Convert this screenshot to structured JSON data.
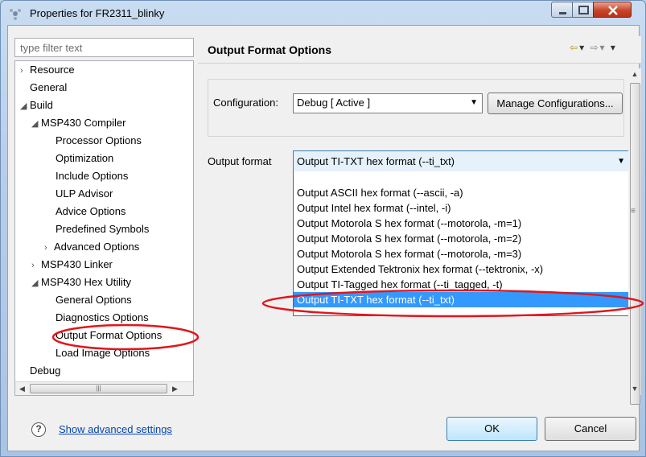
{
  "window": {
    "title": "Properties for FR2311_blinky"
  },
  "filter": {
    "placeholder": "type filter text"
  },
  "tree": {
    "items": [
      {
        "label": "Resource",
        "arrow": "›"
      },
      {
        "label": "General",
        "arrow": ""
      },
      {
        "label": "Build",
        "arrow": "◢"
      },
      {
        "label": "MSP430 Compiler",
        "arrow": "◢"
      },
      {
        "label": "Processor Options",
        "arrow": ""
      },
      {
        "label": "Optimization",
        "arrow": ""
      },
      {
        "label": "Include Options",
        "arrow": ""
      },
      {
        "label": "ULP Advisor",
        "arrow": ""
      },
      {
        "label": "Advice Options",
        "arrow": ""
      },
      {
        "label": "Predefined Symbols",
        "arrow": ""
      },
      {
        "label": "Advanced Options",
        "arrow": "›"
      },
      {
        "label": "MSP430 Linker",
        "arrow": "›"
      },
      {
        "label": "MSP430 Hex Utility",
        "arrow": "◢"
      },
      {
        "label": "General Options",
        "arrow": ""
      },
      {
        "label": "Diagnostics Options",
        "arrow": ""
      },
      {
        "label": "Output Format Options",
        "arrow": ""
      },
      {
        "label": "Load Image Options",
        "arrow": ""
      },
      {
        "label": "Debug",
        "arrow": ""
      }
    ],
    "selected": "Output Format Options"
  },
  "page": {
    "title": "Output Format Options"
  },
  "config": {
    "label": "Configuration:",
    "value": "Debug  [ Active ]",
    "manage_label": "Manage Configurations..."
  },
  "output": {
    "label": "Output format",
    "value": "Output TI-TXT hex format (--ti_txt)",
    "options": [
      "Output ASCII hex format (--ascii, -a)",
      "Output Intel hex format (--intel, -i)",
      "Output Motorola S hex format (--motorola, -m=1)",
      "Output Motorola S hex format (--motorola, -m=2)",
      "Output Motorola S hex format (--motorola, -m=3)",
      "Output Extended Tektronix hex format (--tektronix, -x)",
      "Output TI-Tagged hex format (--ti_tagged, -t)",
      "Output TI-TXT hex format (--ti_txt)"
    ],
    "selected_index": 7
  },
  "footer": {
    "help_glyph": "?",
    "advanced_link": "Show advanced settings",
    "ok_label": "OK",
    "cancel_label": "Cancel"
  },
  "colors": {
    "annotation_red": "#e0161d",
    "selection_blue": "#3399ff"
  }
}
